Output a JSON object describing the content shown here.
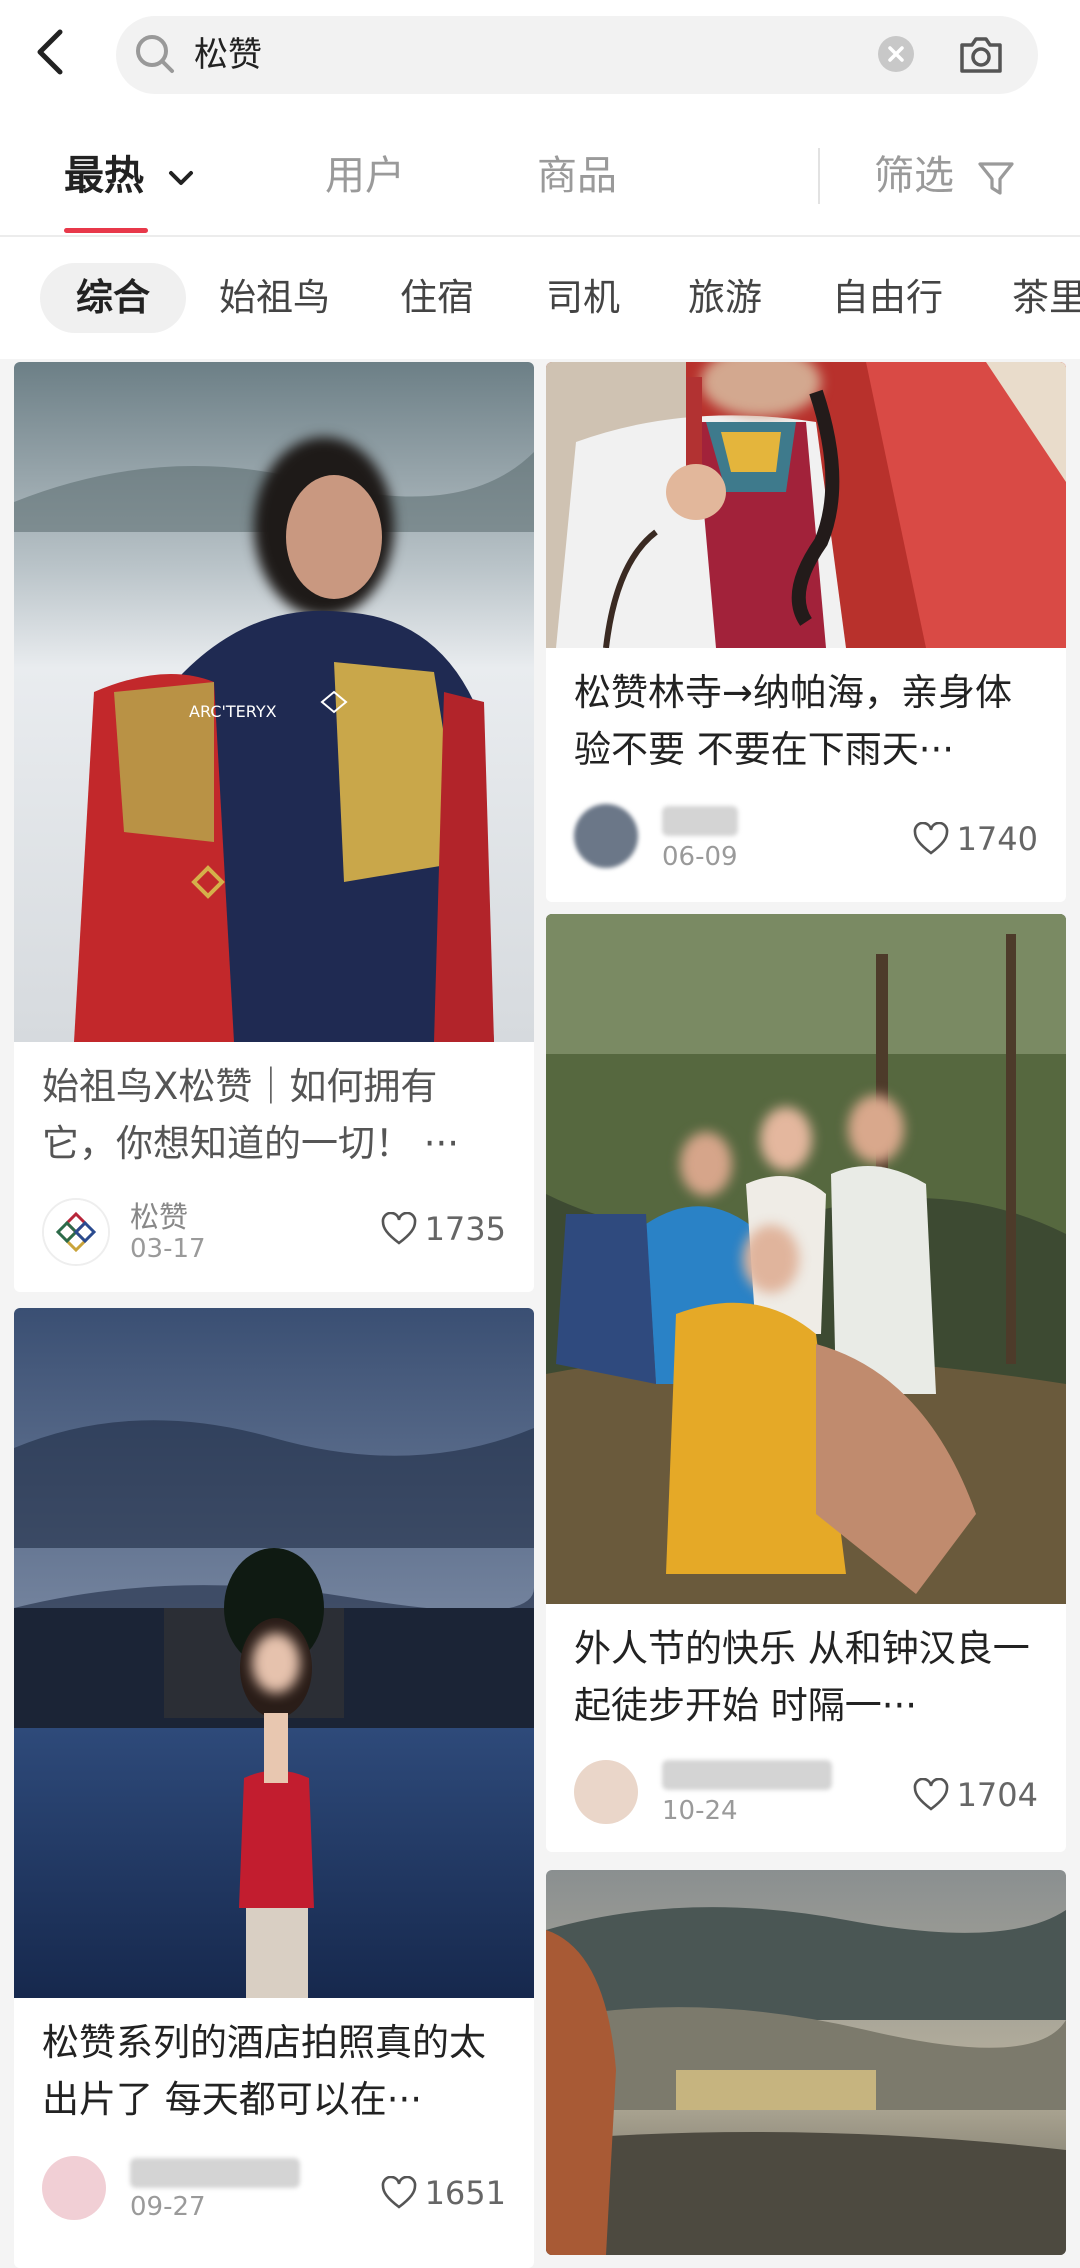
{
  "search": {
    "query": "松赞"
  },
  "sort_tabs": {
    "hot": "最热",
    "users": "用户",
    "goods": "商品",
    "filter": "筛选"
  },
  "chips": [
    "综合",
    "始祖鸟",
    "住宿",
    "司机",
    "旅游",
    "自由行",
    "茶里"
  ],
  "feed": {
    "left": [
      {
        "title": "始祖鸟X松赞｜如何拥有它，你想知道的一切！ ···",
        "author": "松赞",
        "date": "03-17",
        "likes": "1735"
      },
      {
        "title": "松赞系列的酒店拍照真的太出片了 每天都可以在···",
        "author": "",
        "date": "09-27",
        "likes": "1651"
      }
    ],
    "right": [
      {
        "title": "松赞林寺→纳帕海，亲身体验不要 不要在下雨天···",
        "author": "",
        "date": "06-09",
        "likes": "1740"
      },
      {
        "title": "外人节的快乐 从和钟汉良一起徒步开始 时隔一···",
        "author": "",
        "date": "10-24",
        "likes": "1704"
      }
    ]
  },
  "colors": {
    "accent": "#e8384a"
  },
  "icons": [
    "back-arrow-icon",
    "search-icon",
    "clear-icon",
    "camera-icon",
    "chevron-down-icon",
    "filter-icon",
    "heart-icon"
  ]
}
